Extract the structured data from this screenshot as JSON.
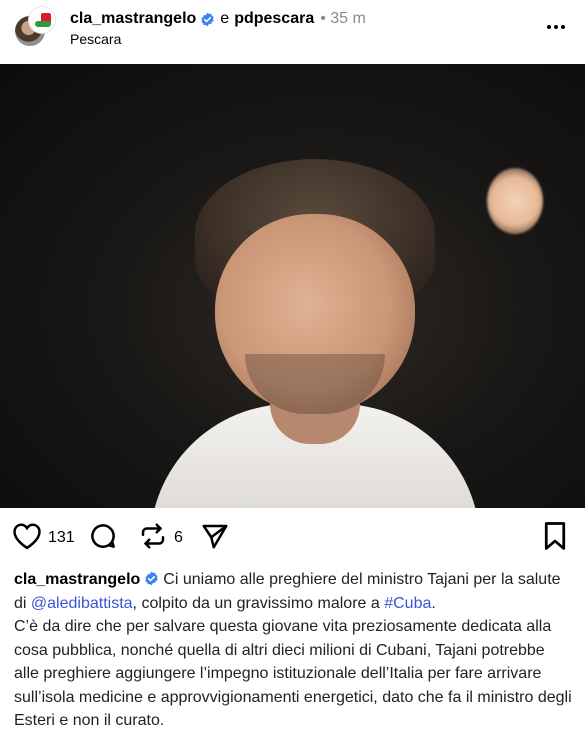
{
  "post": {
    "author": "cla_mastrangelo",
    "and_label": "e",
    "coauthor": "pdpescara",
    "time_meta": "• 35 m",
    "location": "Pescara"
  },
  "actions": {
    "likes": "131",
    "reposts": "6"
  },
  "caption": {
    "author": "cla_mastrangelo",
    "text_1": "Ci uniamo alle preghiere del ministro Tajani per la salute di ",
    "mention": "@aledibattista",
    "text_2": ", colpito da un gravissimo malore a ",
    "hashtag": "#Cuba",
    "text_3": ".",
    "paragraph_2": "C’è da dire che per salvare questa giovane vita preziosamente dedicata alla cosa pubblica, nonché quella di altri dieci milioni di Cubani, Tajani potrebbe alle preghiere aggiungere l’impegno istituzionale dell’Italia per fare arrivare sull’isola medicine e approvvigionamenti energetici, dato che fa il ministro degli Esteri e non il curato."
  },
  "icons": {
    "verified": "verified-badge-icon",
    "like": "heart-icon",
    "comment": "comment-bubble-icon",
    "repost": "repost-icon",
    "share": "send-icon",
    "save": "bookmark-icon",
    "more": "more-dots-icon",
    "tag": "user-tag-icon"
  },
  "colors": {
    "verified": "#3b82f6",
    "link": "#3a55d6",
    "meta": "#8a8a8a"
  }
}
